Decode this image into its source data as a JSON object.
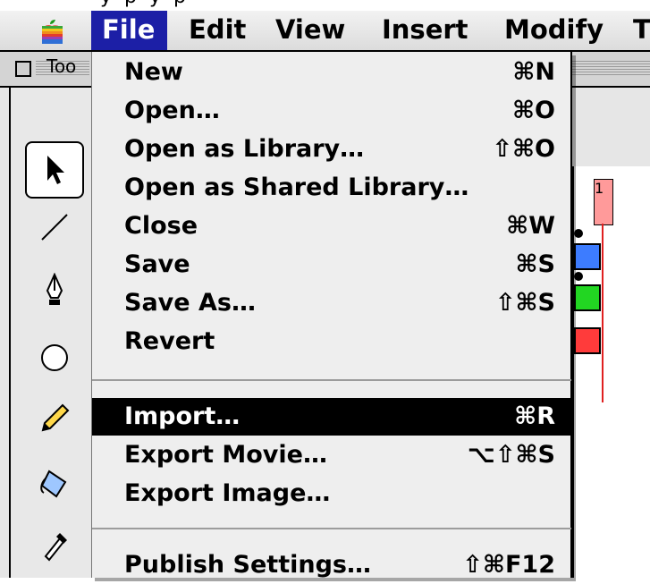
{
  "menubar": {
    "items": [
      {
        "label": "File",
        "active": true
      },
      {
        "label": "Edit"
      },
      {
        "label": "View"
      },
      {
        "label": "Insert"
      },
      {
        "label": "Modify"
      },
      {
        "label": "T"
      }
    ],
    "apple_icon": "apple-logo-icon"
  },
  "window": {
    "tools_label": "Too",
    "tools": [
      "arrow-icon",
      "line-icon",
      "pen-icon",
      "oval-icon",
      "pencil-icon",
      "paint-bucket-icon",
      "eyedropper-icon"
    ],
    "timeline_frame": "1",
    "colors": {
      "blue": "#3d7cff",
      "green": "#22d622",
      "red": "#ff3b3b"
    }
  },
  "file_menu": {
    "items": [
      {
        "label": "New",
        "shortcut": "⌘N"
      },
      {
        "label": "Open…",
        "shortcut": "⌘O"
      },
      {
        "label": "Open as Library…",
        "shortcut": "⇧⌘O"
      },
      {
        "label": "Open as Shared Library…",
        "shortcut": ""
      },
      {
        "label": "Close",
        "shortcut": "⌘W"
      },
      {
        "label": "Save",
        "shortcut": "⌘S"
      },
      {
        "label": "Save As…",
        "shortcut": "⇧⌘S"
      },
      {
        "label": "Revert",
        "shortcut": ""
      },
      {
        "label": "Import…",
        "shortcut": "⌘R",
        "highlighted": true
      },
      {
        "label": "Export Movie…",
        "shortcut": "⌥⇧⌘S"
      },
      {
        "label": "Export Image…",
        "shortcut": ""
      },
      {
        "label": "Publish Settings…",
        "shortcut": "⇧⌘F12"
      }
    ],
    "highlight_color": "#000000"
  }
}
